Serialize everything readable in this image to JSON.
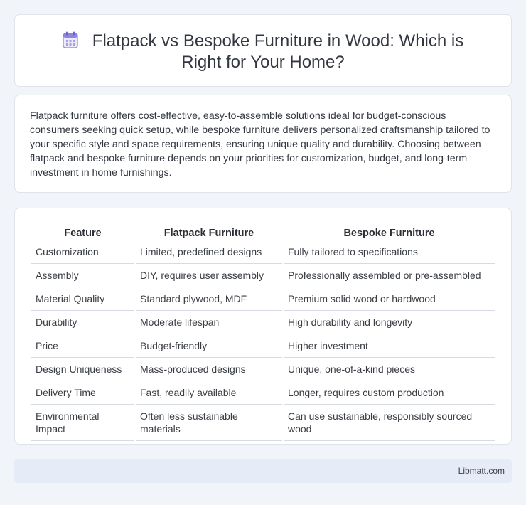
{
  "header": {
    "title": "Flatpack vs Bespoke Furniture in Wood: Which is Right for Your Home?",
    "icon": "calendar-icon"
  },
  "summary": {
    "text": "Flatpack furniture offers cost-effective, easy-to-assemble solutions ideal for budget-conscious consumers seeking quick setup, while bespoke furniture delivers personalized craftsmanship tailored to your specific style and space requirements, ensuring unique quality and durability. Choosing between flatpack and bespoke furniture depends on your priorities for customization, budget, and long-term investment in home furnishings."
  },
  "table": {
    "headers": [
      "Feature",
      "Flatpack Furniture",
      "Bespoke Furniture"
    ],
    "rows": [
      [
        "Customization",
        "Limited, predefined designs",
        "Fully tailored to specifications"
      ],
      [
        "Assembly",
        "DIY, requires user assembly",
        "Professionally assembled or pre-assembled"
      ],
      [
        "Material Quality",
        "Standard plywood, MDF",
        "Premium solid wood or hardwood"
      ],
      [
        "Durability",
        "Moderate lifespan",
        "High durability and longevity"
      ],
      [
        "Price",
        "Budget-friendly",
        "Higher investment"
      ],
      [
        "Design Uniqueness",
        "Mass-produced designs",
        "Unique, one-of-a-kind pieces"
      ],
      [
        "Delivery Time",
        "Fast, readily available",
        "Longer, requires custom production"
      ],
      [
        "Environmental Impact",
        "Often less sustainable materials",
        "Can use sustainable, responsibly sourced wood"
      ]
    ]
  },
  "footer": {
    "brand": "Libmatt.com"
  },
  "colors": {
    "background": "#f1f4f8",
    "card": "#ffffff",
    "footer": "#e6ecf7",
    "icon_accent": "#7b6fd6"
  }
}
